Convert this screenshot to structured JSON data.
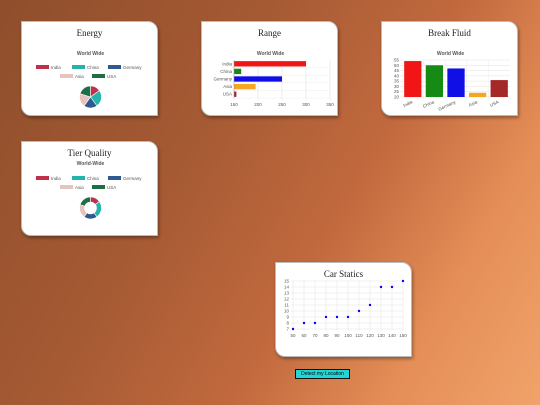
{
  "colors": {
    "India": "#c0304a",
    "China": "#27b3ad",
    "Germany": "#2d5b8f",
    "Asia": "#e6c3be",
    "USA": "#1f6e46"
  },
  "cards": {
    "energy": {
      "title": "Energy"
    },
    "range": {
      "title": "Range"
    },
    "fluid": {
      "title": "Break Fluid"
    },
    "tier": {
      "title": "Tier Quality"
    },
    "car": {
      "title": "Car Statics"
    }
  },
  "detect_button": {
    "label": "Detect my Location"
  },
  "chart_data": [
    {
      "id": "energy",
      "type": "pie",
      "title": "World Wide",
      "legend": [
        "India",
        "China",
        "Germany",
        "Asia",
        "USA"
      ],
      "values": [
        15,
        25,
        20,
        20,
        20
      ],
      "legend_position": "top"
    },
    {
      "id": "range",
      "type": "bar",
      "orientation": "horizontal",
      "title": "World Wide",
      "categories": [
        "India",
        "China",
        "Germany",
        "Asia",
        "USA"
      ],
      "values": [
        300,
        165,
        250,
        195,
        155
      ],
      "colors": [
        "#f01616",
        "#158a15",
        "#1010e6",
        "#f5a623",
        "#a52828"
      ],
      "xlim": [
        150,
        350
      ],
      "xticks": [
        150,
        200,
        250,
        300,
        350
      ],
      "grid": true
    },
    {
      "id": "fluid",
      "type": "bar",
      "title": "World Wide",
      "categories": [
        "India",
        "China",
        "Germany",
        "Asia",
        "USA"
      ],
      "values": [
        54,
        50,
        47,
        24,
        36
      ],
      "colors": [
        "#f01616",
        "#158a15",
        "#1010e6",
        "#f5a623",
        "#a52828"
      ],
      "ylim": [
        20,
        55
      ],
      "yticks": [
        20,
        25,
        30,
        35,
        40,
        45,
        50,
        55
      ],
      "grid": true
    },
    {
      "id": "tier",
      "type": "pie",
      "variant": "doughnut",
      "title": "World-Wide",
      "legend": [
        "India",
        "China",
        "Germany",
        "Asia",
        "USA"
      ],
      "values": [
        15,
        25,
        20,
        20,
        20
      ],
      "legend_position": "top"
    },
    {
      "id": "car",
      "type": "scatter",
      "title": "",
      "x": [
        50,
        60,
        70,
        80,
        90,
        100,
        110,
        120,
        130,
        140,
        150
      ],
      "y": [
        7,
        8,
        8,
        9,
        9,
        9,
        10,
        11,
        14,
        14,
        15
      ],
      "xticks": [
        50,
        60,
        70,
        80,
        90,
        100,
        110,
        120,
        130,
        140,
        150
      ],
      "yticks": [
        7,
        8,
        9,
        10,
        11,
        12,
        13,
        14,
        15
      ],
      "xlim": [
        50,
        150
      ],
      "ylim": [
        7,
        15
      ],
      "point_color": "#0000ff",
      "grid": true
    }
  ]
}
